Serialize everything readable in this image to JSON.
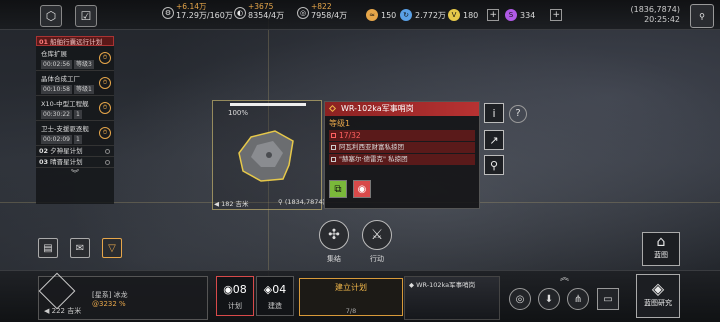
{
  "topbar": {
    "res1": {
      "delta": "+6.14万",
      "value": "17.29万/160万"
    },
    "res2": {
      "delta": "+3675",
      "value": "8354/4万"
    },
    "res3": {
      "delta": "+822",
      "value": "7958/4万"
    },
    "res4_value": "150",
    "res5_value": "2.772万",
    "res6_value": "180",
    "res7_value": "334",
    "coord": "(1836,7874)",
    "time": "20:25:42"
  },
  "tasks": {
    "header_num": "01",
    "header_label": "船舶行囊远行计划",
    "items": [
      {
        "name": "仓库扩展",
        "time": "00:02:56",
        "level": "等级3"
      },
      {
        "name": "晶体合成工厂",
        "time": "00:10:58",
        "level": "等级1"
      },
      {
        "name": "X10-中型工程舰",
        "time": "00:30:22",
        "level": "1"
      },
      {
        "name": "卫士-支援驱逐舰",
        "time": "00:02:09",
        "level": "1"
      }
    ],
    "plans": [
      {
        "num": "02",
        "label": "夕神星计划"
      },
      {
        "num": "03",
        "label": "晴晋星计划"
      }
    ],
    "more": "移动舰队计划"
  },
  "target": {
    "hp_pct": "100%",
    "distance": "182 吉米",
    "coord": "(1834,7874)"
  },
  "info": {
    "title": "WR-102ka军事哨岗",
    "level": "等级1",
    "count": "17/32",
    "owner": "阿瓦利西亚财富私掠团",
    "guild": "\"赫塞尔·德雷克\" 私掠团"
  },
  "actions": {
    "gather": "集结",
    "move": "行动"
  },
  "bottom": {
    "player_dist": "222 吉米",
    "player_tag": "[星系] 冰龙",
    "player_power": "@3232 %",
    "plan_count": "08",
    "plan_label": "计划",
    "build_count": "04",
    "build_label": "建造",
    "build_plan_title": "建立计划",
    "build_plan_sub": "7/8",
    "preview_title": "WR-102ka军事哨岗",
    "blueprint": "蓝图",
    "research": "蓝图研究"
  }
}
